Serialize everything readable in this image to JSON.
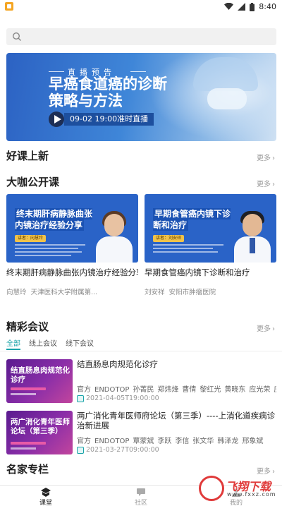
{
  "status_bar": {
    "time": "8:40"
  },
  "search": {
    "placeholder": ""
  },
  "banner": {
    "kicker": "直播预告",
    "title": "早癌食道癌的诊断策略与方法",
    "live_time": "09-02 19:00准时直播"
  },
  "sections": {
    "new_courses": {
      "title": "好课上新",
      "more": "更多"
    },
    "open_courses": {
      "title": "大咖公开课",
      "more": "更多"
    },
    "meetings": {
      "title": "精彩会议",
      "more": "更多"
    },
    "experts": {
      "title": "名家专栏",
      "more": "更多"
    }
  },
  "open_courses": [
    {
      "thumb_title": "终末期肝病静脉曲张内镜治疗经验分享",
      "speaker_tag": "讲者：向慧玲",
      "name": "终末期肝病静脉曲张内镜治疗经验分享",
      "author": "向慧玲",
      "org": "天津医科大学附属第..."
    },
    {
      "thumb_title": "早期食管癌内镜下诊断和治疗",
      "speaker_tag": "讲者：刘安祥",
      "name": "早期食管癌内镜下诊断和治疗",
      "author": "刘安祥",
      "org": "安阳市肿瘤医院"
    }
  ],
  "meeting_tabs": [
    {
      "label": "全部",
      "active": true
    },
    {
      "label": "线上会议",
      "active": false
    },
    {
      "label": "线下会议",
      "active": false
    }
  ],
  "meetings": [
    {
      "thumb_title": "结直肠息肉规范化诊疗",
      "title": "结直肠息肉规范化诊疗",
      "tags": [
        "官方",
        "ENDOTOP",
        "孙菁民",
        "郑炜烽",
        "曹倩",
        "黎红光",
        "黄晓东",
        "应光荣",
        "庄学"
      ],
      "date": "2021-04-05T19:00:00"
    },
    {
      "thumb_title": "两广消化青年医师论坛（第三季）",
      "title": "两广消化青年医师府论坛（第三季）----上消化道疾病诊治新进展",
      "tags": [
        "官方",
        "ENDOTOP",
        "覃蒙斌",
        "李跃",
        "李信",
        "张文华",
        "韩泽龙",
        "邢象斌"
      ],
      "date": "2021-03-27T09:00:00"
    }
  ],
  "bottom_nav": [
    {
      "label": "课堂",
      "icon": "classroom-icon",
      "active": true
    },
    {
      "label": "社区",
      "icon": "community-icon",
      "active": false
    },
    {
      "label": "我的",
      "icon": "profile-icon",
      "active": false
    }
  ],
  "watermark": {
    "logo": "飞翔下载",
    "url": "www.fxxz.com"
  },
  "colors": {
    "accent": "#19a4a9",
    "banner_blue": "#2c62c3",
    "meeting_purple": "#7a2aa0"
  }
}
